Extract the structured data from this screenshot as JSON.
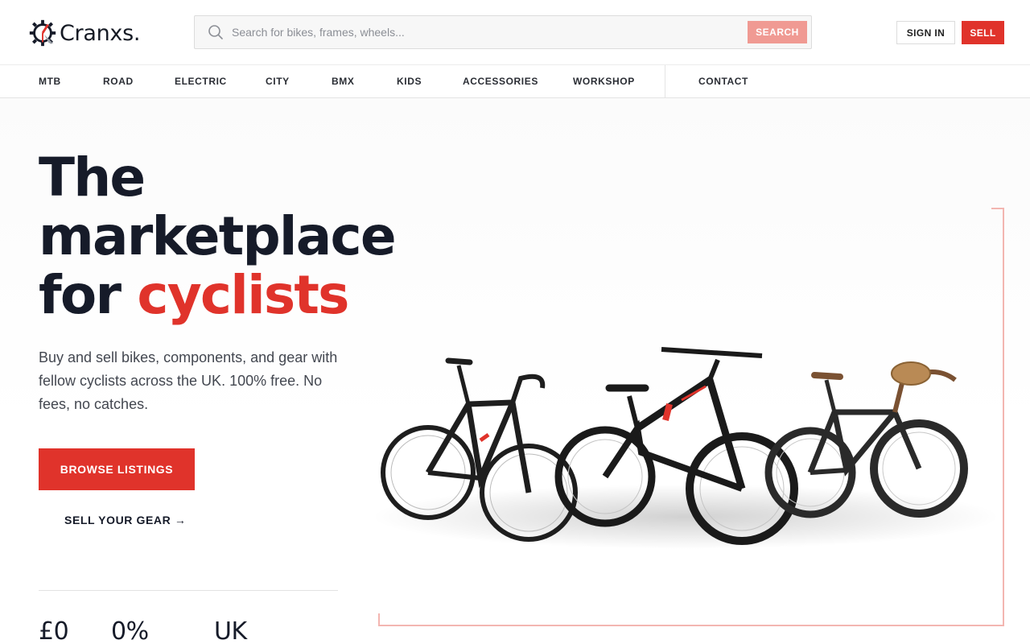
{
  "brand": {
    "name": "Cranxs."
  },
  "search": {
    "placeholder": "Search for bikes, frames, wheels...",
    "button_label": "SEARCH"
  },
  "auth": {
    "signin_label": "SIGN IN",
    "sell_label": "SELL"
  },
  "nav": {
    "items": [
      {
        "label": "MTB"
      },
      {
        "label": "ROAD"
      },
      {
        "label": "ELECTRIC"
      },
      {
        "label": "CITY"
      },
      {
        "label": "BMX"
      },
      {
        "label": "KIDS"
      },
      {
        "label": "ACCESSORIES"
      },
      {
        "label": "WORKSHOP"
      },
      {
        "label": "CONTACT"
      }
    ]
  },
  "hero": {
    "headline_line1": "The",
    "headline_line2": "marketplace",
    "headline_line3_start": "for ",
    "headline_accent": "cyclists",
    "subtext": "Buy and sell bikes, components, and gear with fellow cyclists across the UK. 100% free. No fees, no catches.",
    "browse_label": "BROWSE LISTINGS",
    "sell_link_label": "SELL YOUR GEAR →",
    "stats": [
      {
        "value": "£0"
      },
      {
        "value": "0%"
      },
      {
        "value": "UK"
      }
    ]
  },
  "colors": {
    "accent": "#e0332b",
    "accent_light": "#f09a93",
    "text_dark": "#161b29",
    "frame_line": "#f3b6b1"
  },
  "icons": {
    "search": "search-icon",
    "logo": "gear-logo-icon"
  }
}
